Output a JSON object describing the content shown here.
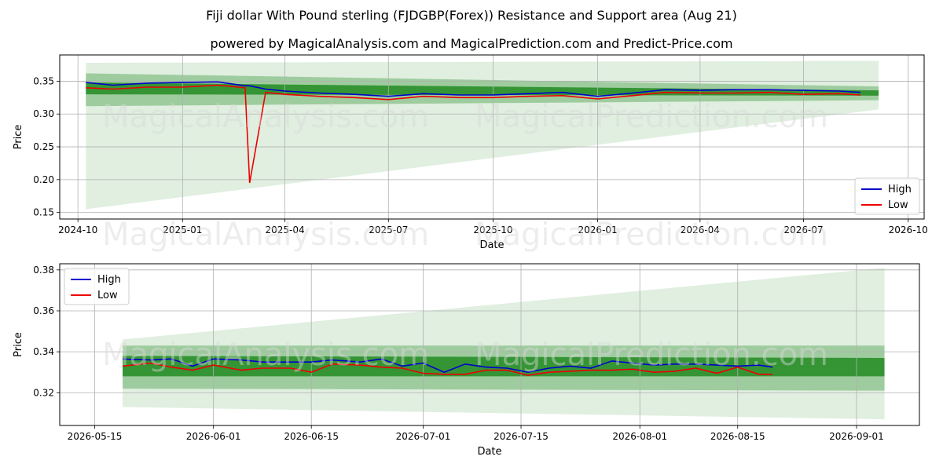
{
  "title": "Fiji dollar With Pound sterling (FJDGBP(Forex)) Resistance and Support area (Aug 21)",
  "subtitle": "powered by MagicalAnalysis.com and MagicalPrediction.com and Predict-Price.com",
  "watermarks": [
    "MagicalAnalysis.com",
    "MagicalPrediction.com"
  ],
  "colors": {
    "high": "#0000cc",
    "low": "#ee0000",
    "band": "#228b22",
    "grid": "#b0b0b0"
  },
  "chart_data": [
    {
      "type": "line",
      "xlabel": "Date",
      "ylabel": "Price",
      "x_ticks": [
        "2024-10",
        "2025-01",
        "2025-04",
        "2025-07",
        "2025-10",
        "2026-01",
        "2026-04",
        "2026-07",
        "2026-10"
      ],
      "y_ticks": [
        "0.15",
        "0.20",
        "0.25",
        "0.30",
        "0.35"
      ],
      "xlim": [
        "2024-09-15",
        "2026-10-15"
      ],
      "ylim": [
        0.14,
        0.39
      ],
      "legend": {
        "position": "bottom-right",
        "entries": [
          "High",
          "Low"
        ]
      },
      "grid": true,
      "x": [
        "2024-10-08",
        "2024-11-01",
        "2024-12-01",
        "2025-01-01",
        "2025-02-01",
        "2025-02-25",
        "2025-03-01",
        "2025-03-15",
        "2025-04-01",
        "2025-05-01",
        "2025-06-01",
        "2025-07-01",
        "2025-08-01",
        "2025-09-01",
        "2025-10-01",
        "2025-11-01",
        "2025-12-01",
        "2026-01-01",
        "2026-02-01",
        "2026-03-01",
        "2026-04-01",
        "2026-05-01",
        "2026-06-01",
        "2026-07-01",
        "2026-08-01",
        "2026-08-20"
      ],
      "series": [
        {
          "name": "High",
          "values": [
            0.348,
            0.344,
            0.347,
            0.348,
            0.349,
            0.343,
            0.343,
            0.338,
            0.335,
            0.332,
            0.33,
            0.327,
            0.331,
            0.329,
            0.329,
            0.331,
            0.333,
            0.327,
            0.332,
            0.337,
            0.336,
            0.337,
            0.337,
            0.336,
            0.335,
            0.333
          ]
        },
        {
          "name": "Low",
          "values": [
            0.34,
            0.338,
            0.341,
            0.341,
            0.344,
            0.34,
            0.195,
            0.333,
            0.33,
            0.327,
            0.325,
            0.322,
            0.327,
            0.325,
            0.325,
            0.327,
            0.328,
            0.323,
            0.328,
            0.333,
            0.332,
            0.332,
            0.333,
            0.33,
            0.331,
            0.329
          ]
        }
      ],
      "bands": {
        "x": [
          "2024-10-08",
          "2026-09-05"
        ],
        "light_upper": [
          0.378,
          0.381
        ],
        "light_lower": [
          0.155,
          0.307
        ],
        "mid_upper": [
          0.362,
          0.342
        ],
        "mid_lower": [
          0.312,
          0.321
        ],
        "dark_upper": [
          0.348,
          0.336
        ],
        "dark_lower": [
          0.33,
          0.328
        ]
      }
    },
    {
      "type": "line",
      "xlabel": "Date",
      "ylabel": "Price",
      "x_ticks": [
        "2026-05-15",
        "2026-06-01",
        "2026-06-15",
        "2026-07-01",
        "2026-07-15",
        "2026-08-01",
        "2026-08-15",
        "2026-09-01"
      ],
      "y_ticks": [
        "0.32",
        "0.34",
        "0.36",
        "0.38"
      ],
      "xlim": [
        "2026-05-10",
        "2026-09-10"
      ],
      "ylim": [
        0.304,
        0.383
      ],
      "legend": {
        "position": "top-left",
        "entries": [
          "High",
          "Low"
        ]
      },
      "grid": true,
      "x": [
        "2026-05-19",
        "2026-05-23",
        "2026-05-26",
        "2026-05-29",
        "2026-06-01",
        "2026-06-05",
        "2026-06-08",
        "2026-06-12",
        "2026-06-15",
        "2026-06-18",
        "2026-06-22",
        "2026-06-25",
        "2026-06-28",
        "2026-07-01",
        "2026-07-04",
        "2026-07-07",
        "2026-07-10",
        "2026-07-13",
        "2026-07-16",
        "2026-07-19",
        "2026-07-22",
        "2026-07-25",
        "2026-07-28",
        "2026-07-31",
        "2026-08-03",
        "2026-08-06",
        "2026-08-09",
        "2026-08-12",
        "2026-08-15",
        "2026-08-18",
        "2026-08-20"
      ],
      "series": [
        {
          "name": "High",
          "values": [
            0.3365,
            0.336,
            0.3365,
            0.333,
            0.3365,
            0.336,
            0.335,
            0.335,
            0.335,
            0.336,
            0.335,
            0.3365,
            0.333,
            0.3345,
            0.33,
            0.334,
            0.3325,
            0.332,
            0.33,
            0.332,
            0.333,
            0.332,
            0.3355,
            0.3345,
            0.3335,
            0.334,
            0.334,
            0.3335,
            0.333,
            0.3335,
            0.3325
          ]
        },
        {
          "name": "Low",
          "values": [
            0.333,
            0.3345,
            0.3325,
            0.331,
            0.3335,
            0.331,
            0.332,
            0.332,
            0.33,
            0.334,
            0.3335,
            0.3325,
            0.332,
            0.3295,
            0.329,
            0.329,
            0.331,
            0.331,
            0.3285,
            0.33,
            0.3305,
            0.331,
            0.331,
            0.3315,
            0.33,
            0.3305,
            0.332,
            0.3295,
            0.3325,
            0.329,
            0.329
          ]
        }
      ],
      "bands": {
        "x": [
          "2026-05-19",
          "2026-09-05"
        ],
        "light_upper": [
          0.346,
          0.381
        ],
        "light_lower": [
          0.313,
          0.307
        ],
        "mid_upper": [
          0.343,
          0.343
        ],
        "mid_lower": [
          0.322,
          0.321
        ],
        "dark_upper": [
          0.338,
          0.337
        ],
        "dark_lower": [
          0.328,
          0.328
        ]
      }
    }
  ]
}
